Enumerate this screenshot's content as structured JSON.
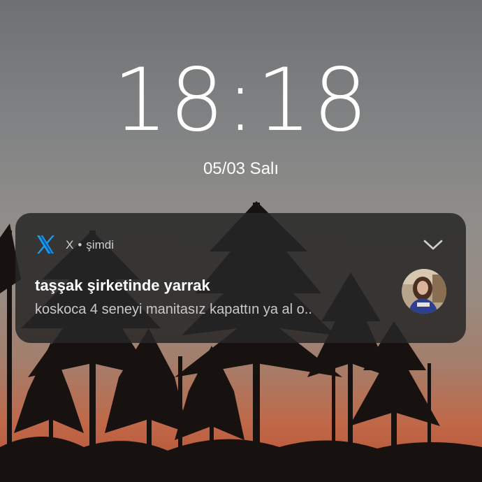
{
  "lockscreen": {
    "time": "18:18",
    "date": "05/03 Salı"
  },
  "notification": {
    "app_icon": "x-logo-icon",
    "app_name": "X",
    "separator": "•",
    "timestamp": "şimdi",
    "title": "taşşak şirketinde yarrak",
    "body": "koskoca 4 seneyi manitasız kapattın ya al o..",
    "expand_icon": "chevron-down-icon",
    "avatar": "avatar-photo"
  },
  "colors": {
    "card_background": "#262626",
    "text_primary": "#ffffff",
    "text_secondary": "#c9c9c9",
    "x_logo_blue": "#1d9bf0"
  }
}
